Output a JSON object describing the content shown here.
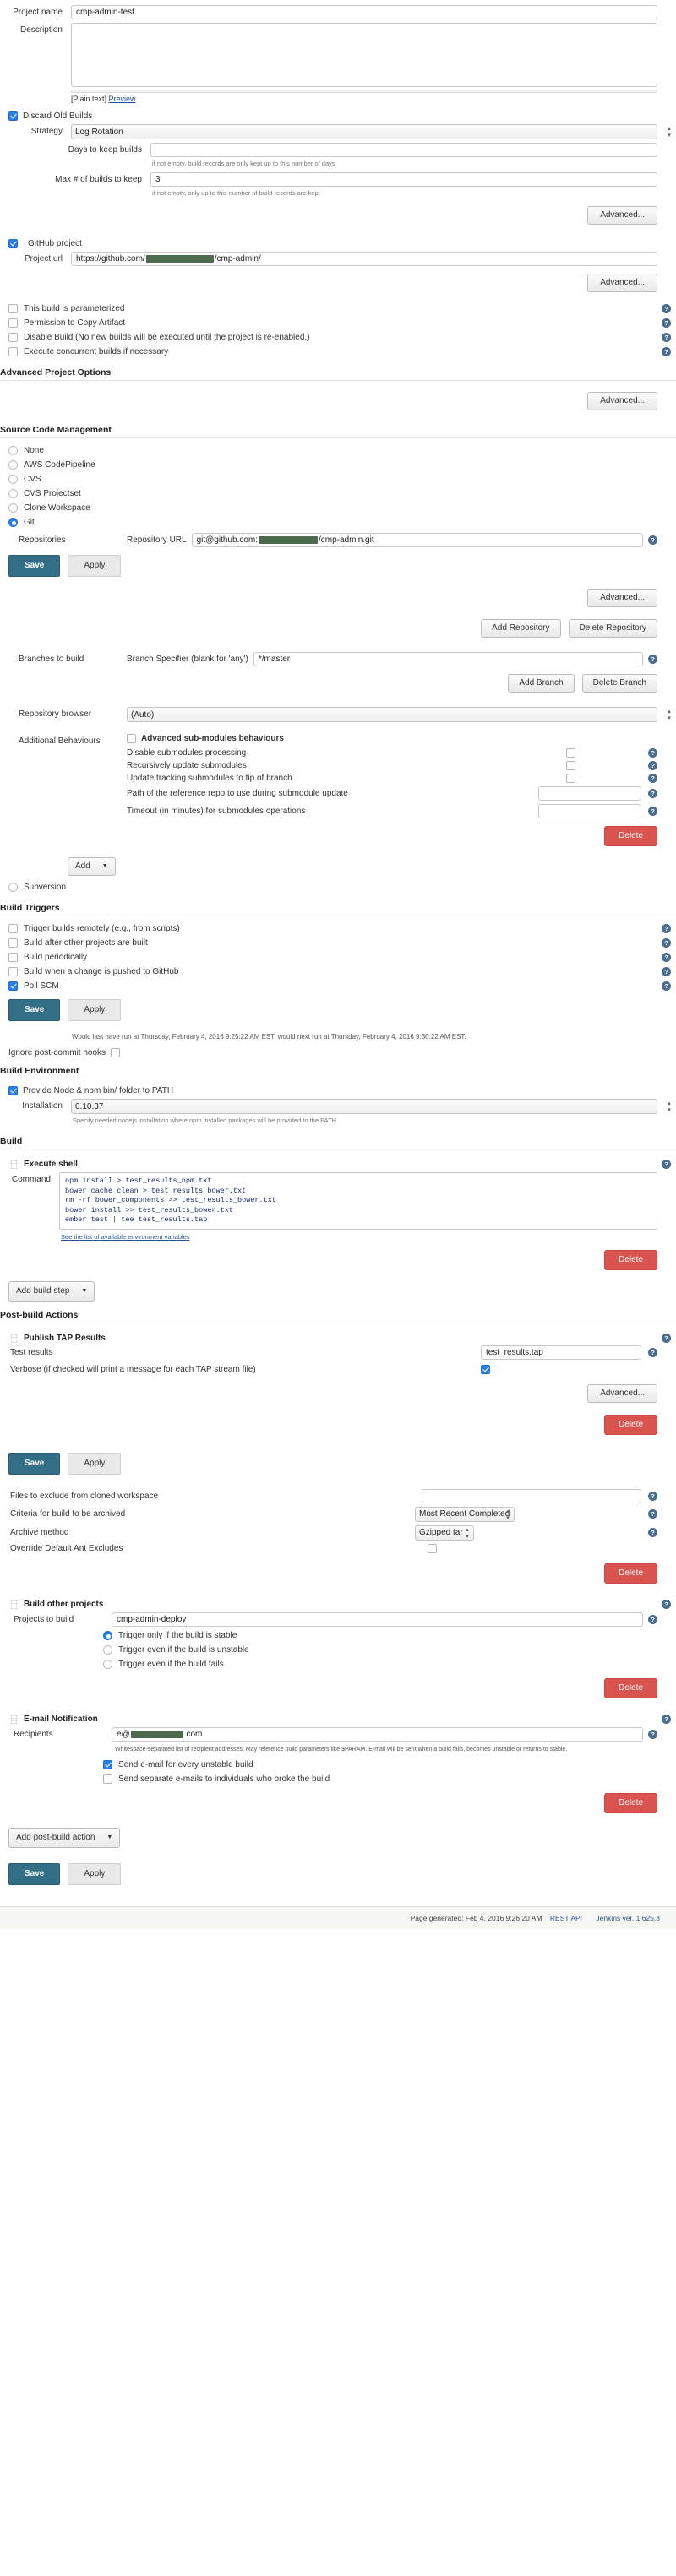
{
  "general": {
    "project_name_label": "Project name",
    "project_name_value": "cmp-admin-test",
    "description_label": "Description",
    "description_value": "",
    "plain_text_label": "[Plain text]",
    "preview_label": "Preview",
    "discard_old_builds_label": "Discard Old Builds",
    "strategy_label": "Strategy",
    "strategy_value": "Log Rotation",
    "days_to_keep_label": "Days to keep builds",
    "days_to_keep_value": "",
    "days_to_keep_note": "if not empty, build records are only kept up to this number of days",
    "max_builds_label": "Max # of builds to keep",
    "max_builds_value": "3",
    "max_builds_note": "if not empty, only up to this number of build records are kept",
    "advanced_label": "Advanced..."
  },
  "github": {
    "github_project_label": "GitHub project",
    "project_url_label": "Project url",
    "project_url_prefix": "https://github.com/",
    "project_url_suffix": "/cmp-admin/",
    "advanced_label": "Advanced..."
  },
  "options": {
    "parameterized_label": "This build is parameterized",
    "copy_artifact_label": "Permission to Copy Artifact",
    "disable_build_label": "Disable Build (No new builds will be executed until the project is re-enabled.)",
    "concurrent_label": "Execute concurrent builds if necessary"
  },
  "advanced_project_options": {
    "heading": "Advanced Project Options",
    "advanced_label": "Advanced..."
  },
  "scm": {
    "heading": "Source Code Management",
    "options": [
      {
        "label": "None",
        "selected": false
      },
      {
        "label": "AWS CodePipeline",
        "selected": false
      },
      {
        "label": "CVS",
        "selected": false
      },
      {
        "label": "CVS Projectset",
        "selected": false
      },
      {
        "label": "Clone Workspace",
        "selected": false
      },
      {
        "label": "Git",
        "selected": true
      }
    ],
    "repositories_label": "Repositories",
    "repository_url_label": "Repository URL",
    "repository_url_prefix": "git@github.com:",
    "repository_url_suffix": "/cmp-admin.git",
    "save_label": "Save",
    "apply_label": "Apply",
    "advanced_label": "Advanced...",
    "add_repository_label": "Add Repository",
    "delete_repository_label": "Delete Repository",
    "branches_to_build_label": "Branches to build",
    "branch_specifier_label": "Branch Specifier (blank for 'any')",
    "branch_specifier_value": "*/master",
    "add_branch_label": "Add Branch",
    "delete_branch_label": "Delete Branch",
    "repository_browser_label": "Repository browser",
    "repository_browser_value": "(Auto)",
    "additional_behaviours_label": "Additional Behaviours",
    "advanced_submodules_label": "Advanced sub-modules behaviours",
    "disable_submodules_label": "Disable submodules processing",
    "recursively_update_label": "Recursively update submodules",
    "update_tracking_label": "Update tracking submodules to tip of branch",
    "path_reference_repo_label": "Path of the reference repo to use during submodule update",
    "path_reference_repo_value": "",
    "timeout_label": "Timeout (in minutes) for submodules operations",
    "timeout_value": "",
    "delete_label": "Delete",
    "add_label": "Add",
    "subversion_label": "Subversion"
  },
  "build_triggers": {
    "heading": "Build Triggers",
    "items": [
      {
        "label": "Trigger builds remotely (e.g., from scripts)",
        "checked": false
      },
      {
        "label": "Build after other projects are built",
        "checked": false
      },
      {
        "label": "Build periodically",
        "checked": false
      },
      {
        "label": "Build when a change is pushed to GitHub",
        "checked": false
      },
      {
        "label": "Poll SCM",
        "checked": true
      }
    ],
    "save_label": "Save",
    "apply_label": "Apply",
    "schedule_note": "Would last have run at Thursday, February 4, 2016 9:25:22 AM EST; would next run at Thursday, February 4, 2016 9:30:22 AM EST.",
    "ignore_post_commit_label": "Ignore post-commit hooks"
  },
  "build_environment": {
    "heading": "Build Environment",
    "provide_node_label": "Provide Node & npm bin/ folder to PATH",
    "installation_label": "Installation",
    "installation_value": "0.10.37",
    "installation_note": "Specify needed nodejs installation where npm installed packages will be provided to the PATH"
  },
  "build": {
    "heading": "Build",
    "execute_shell_label": "Execute shell",
    "command_label": "Command",
    "command_value": "npm install > test_results_npm.txt\nbower cache clean > test_results_bower.txt\nrm -rf bower_components >> test_results_bower.txt\nbower install >> test_results_bower.txt\nember test | tee test_results.tap",
    "env_link_text": "See the list of available environment variables",
    "delete_label": "Delete",
    "add_build_step_label": "Add build step"
  },
  "post_build": {
    "heading": "Post-build Actions",
    "publish_tap_label": "Publish TAP Results",
    "test_results_label": "Test results",
    "test_results_value": "test_results.tap",
    "verbose_label": "Verbose (if checked will print a message for each TAP stream file)",
    "advanced_label": "Advanced...",
    "delete_label": "Delete",
    "save_label": "Save",
    "apply_label": "Apply",
    "files_to_exclude_label": "Files to exclude from cloned workspace",
    "files_to_exclude_value": "",
    "criteria_label": "Criteria for build to be archived",
    "criteria_value": "Most Recent Completed Build",
    "archive_method_label": "Archive method",
    "archive_method_value": "Gzipped tar",
    "override_ant_label": "Override Default Ant Excludes",
    "build_other_projects_label": "Build other projects",
    "projects_to_build_label": "Projects to build",
    "projects_to_build_value": "cmp-admin-deploy",
    "trigger_options": [
      {
        "label": "Trigger only if the build is stable",
        "selected": true
      },
      {
        "label": "Trigger even if the build is unstable",
        "selected": false
      },
      {
        "label": "Trigger even if the build fails",
        "selected": false
      }
    ],
    "email_notification_label": "E-mail Notification",
    "recipients_label": "Recipients",
    "recipients_prefix": "e@",
    "recipients_suffix": ".com",
    "recipients_note": "Whitespace-separated list of recipient addresses. May reference build parameters like $PARAM. E-mail will be sent when a build fails, becomes unstable or returns to stable.",
    "send_email_unstable_label": "Send e-mail for every unstable build",
    "send_separate_label": "Send separate e-mails to individuals who broke the build",
    "add_post_build_action_label": "Add post-build action"
  },
  "bottom": {
    "save_label": "Save",
    "apply_label": "Apply"
  },
  "footer": {
    "page_generated": "Page generated: Feb 4, 2016 9:26:20 AM",
    "rest_api": "REST API",
    "jenkins_version": "Jenkins ver. 1.625.3"
  }
}
